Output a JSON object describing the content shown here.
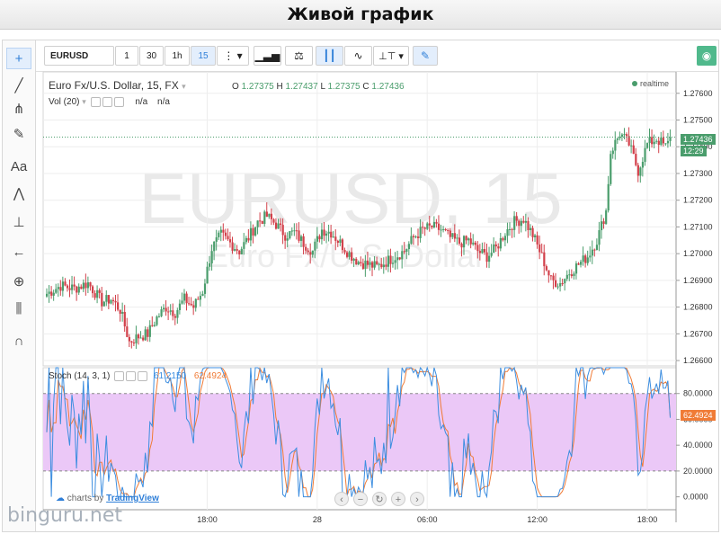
{
  "page": {
    "heading": "Живой график"
  },
  "toolbar": {
    "symbol": "EURUSD",
    "intervals": [
      {
        "label": "1"
      },
      {
        "label": "30"
      },
      {
        "label": "1h"
      },
      {
        "label": "15"
      }
    ],
    "active_interval": "15"
  },
  "left_tools": [
    {
      "icon": "crosshair-icon",
      "glyph": "+"
    },
    {
      "icon": "trend-line-icon",
      "glyph": "╱"
    },
    {
      "icon": "pitchfork-icon",
      "glyph": "⋔"
    },
    {
      "icon": "brush-icon",
      "glyph": "✎"
    },
    {
      "icon": "text-tool-icon",
      "glyph": "Aa"
    },
    {
      "icon": "pattern-icon",
      "glyph": "⋀"
    },
    {
      "icon": "measure-icon",
      "glyph": "⊥"
    },
    {
      "icon": "back-arrow-icon",
      "glyph": "←"
    },
    {
      "icon": "zoom-icon",
      "glyph": "⊕"
    },
    {
      "icon": "bars-pattern-icon",
      "glyph": "⫼"
    },
    {
      "icon": "magnet-icon",
      "glyph": "∩"
    }
  ],
  "main_legend": {
    "title": "Euro Fx/U.S. Dollar, 15, FX",
    "o_label": "O",
    "o": "1.27375",
    "h_label": "H",
    "h": "1.27437",
    "l_label": "L",
    "l": "1.27375",
    "c_label": "C",
    "c": "1.27436"
  },
  "volume_legend": {
    "label": "Vol (20)",
    "v1": "n/a",
    "v2": "n/a"
  },
  "realtime_label": "realtime",
  "watermark": {
    "symbol": "EURUSD, 15",
    "name": "Euro Fx/U.S. Dollar"
  },
  "price_tags": {
    "last": "1.27436",
    "countdown": "12:29"
  },
  "stoch_legend": {
    "label": "Stoch (14, 3, 1)",
    "k": "61.2150",
    "d": "62.4924",
    "k_color": "#3d8ee0",
    "d_color": "#f07b36"
  },
  "stoch_tag": "62.4924",
  "colors": {
    "up": "#4a9d6c",
    "down": "#d2404a",
    "stoch_band": "#ebc8f7"
  },
  "footer": {
    "prefix": "charts by",
    "brand": "TradingView"
  },
  "chart_data": [
    {
      "type": "candlestick",
      "title": "Euro Fx/U.S. Dollar, 15, FX",
      "ylim": [
        1.2658,
        1.2768
      ],
      "yticks": [
        1.266,
        1.267,
        1.268,
        1.269,
        1.27,
        1.271,
        1.272,
        1.273,
        1.274,
        1.275,
        1.276
      ],
      "ytick_labels": [
        "1.26600",
        "1.26700",
        "1.26800",
        "1.26900",
        "1.27000",
        "1.27100",
        "1.27200",
        "1.27300",
        "1.27400",
        "1.27500",
        "1.27600"
      ],
      "xticks": [
        {
          "index": 70,
          "label": "18:00"
        },
        {
          "index": 118,
          "label": "28"
        },
        {
          "index": 166,
          "label": "06:00"
        },
        {
          "index": 214,
          "label": "12:00"
        },
        {
          "index": 262,
          "label": "18:00"
        }
      ],
      "candles_count": 273,
      "close_path": [
        [
          0,
          1.2685
        ],
        [
          6,
          1.2688
        ],
        [
          12,
          1.2687
        ],
        [
          18,
          1.2689
        ],
        [
          24,
          1.2682
        ],
        [
          28,
          1.2683
        ],
        [
          32,
          1.2679
        ],
        [
          36,
          1.2667
        ],
        [
          40,
          1.2669
        ],
        [
          44,
          1.267
        ],
        [
          48,
          1.2676
        ],
        [
          52,
          1.268
        ],
        [
          56,
          1.2678
        ],
        [
          60,
          1.2683
        ],
        [
          64,
          1.268
        ],
        [
          68,
          1.2686
        ],
        [
          72,
          1.2702
        ],
        [
          76,
          1.2707
        ],
        [
          80,
          1.2704
        ],
        [
          84,
          1.2701
        ],
        [
          88,
          1.2706
        ],
        [
          92,
          1.2712
        ],
        [
          96,
          1.2714
        ],
        [
          100,
          1.2711
        ],
        [
          104,
          1.2707
        ],
        [
          108,
          1.2708
        ],
        [
          112,
          1.2704
        ],
        [
          116,
          1.2701
        ],
        [
          120,
          1.2709
        ],
        [
          124,
          1.2708
        ],
        [
          128,
          1.2704
        ],
        [
          132,
          1.27
        ],
        [
          136,
          1.2697
        ],
        [
          140,
          1.2696
        ],
        [
          144,
          1.2695
        ],
        [
          148,
          1.2697
        ],
        [
          152,
          1.2699
        ],
        [
          156,
          1.2701
        ],
        [
          160,
          1.2706
        ],
        [
          164,
          1.2709
        ],
        [
          168,
          1.271
        ],
        [
          172,
          1.2709
        ],
        [
          176,
          1.2706
        ],
        [
          180,
          1.2704
        ],
        [
          184,
          1.2705
        ],
        [
          188,
          1.2701
        ],
        [
          192,
          1.2699
        ],
        [
          196,
          1.2702
        ],
        [
          200,
          1.2708
        ],
        [
          204,
          1.2712
        ],
        [
          208,
          1.2713
        ],
        [
          212,
          1.2707
        ],
        [
          216,
          1.2699
        ],
        [
          220,
          1.269
        ],
        [
          224,
          1.2689
        ],
        [
          228,
          1.2693
        ],
        [
          232,
          1.2696
        ],
        [
          236,
          1.2699
        ],
        [
          240,
          1.2705
        ],
        [
          244,
          1.2716
        ],
        [
          246,
          1.2738
        ],
        [
          250,
          1.2745
        ],
        [
          254,
          1.2741
        ],
        [
          258,
          1.2731
        ],
        [
          262,
          1.2741
        ],
        [
          266,
          1.2743
        ],
        [
          270,
          1.274
        ],
        [
          273,
          1.27436
        ]
      ],
      "last_price": 1.27436
    },
    {
      "type": "line",
      "title": "Stoch (14, 3, 1)",
      "ylim": [
        -10,
        100
      ],
      "yticks": [
        0,
        20,
        40,
        60,
        80
      ],
      "ytick_labels": [
        "0.0000",
        "20.0000",
        "40.0000",
        "60.0000",
        "80.0000"
      ],
      "band": [
        20,
        80
      ],
      "series": [
        {
          "name": "61.2150",
          "color": "#3d8ee0"
        },
        {
          "name": "62.4924",
          "color": "#f07b36"
        }
      ],
      "last_k": 61.215,
      "last_d": 62.4924
    }
  ]
}
